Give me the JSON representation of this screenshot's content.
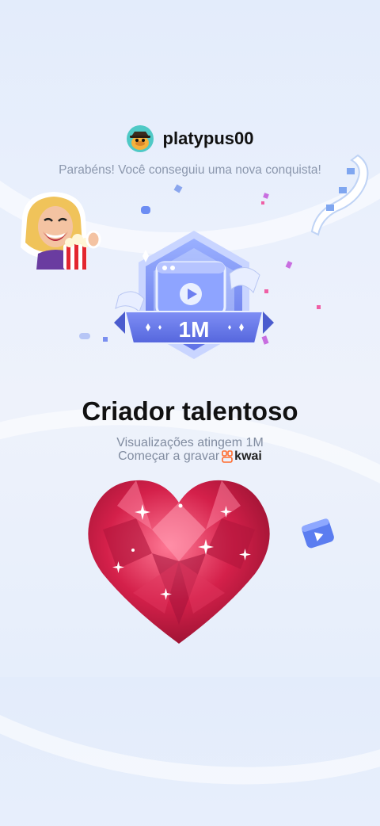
{
  "header": {
    "username": "platypus00",
    "message": "Parabéns! Você conseguiu uma nova conquista!"
  },
  "badge": {
    "label": "1M"
  },
  "achievement": {
    "title": "Criador talentoso",
    "description": "Visualizações atingem 1M",
    "cta_text": "Começar a gravar",
    "brand": "kwai"
  },
  "icons": [
    "avatar",
    "sticker",
    "badge-icon",
    "film-strip-icon",
    "heart-gem-icon",
    "play-tile-icon",
    "kwai-logo-icon"
  ],
  "colors": {
    "badge_blue": "#6d7ff0",
    "brand_orange": "#ff6a2c",
    "heart_red": "#d4204a"
  }
}
